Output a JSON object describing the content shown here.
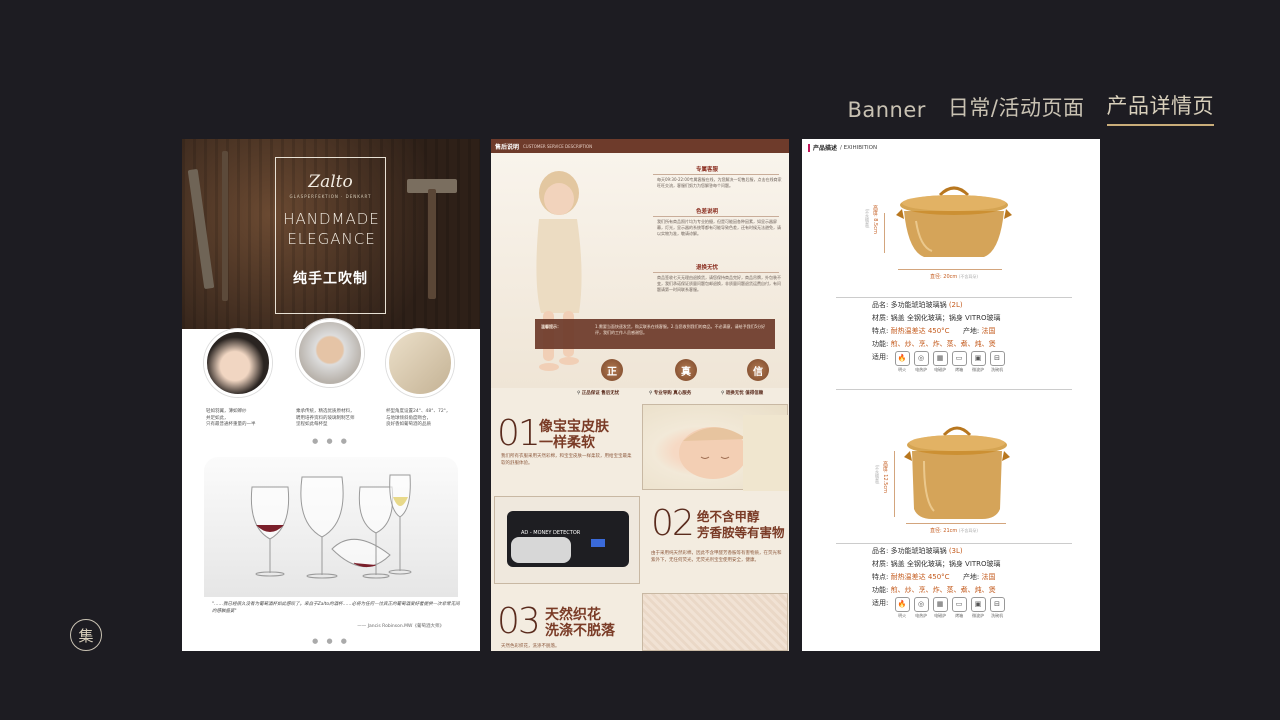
{
  "nav": {
    "items": [
      {
        "label": "Banner",
        "active": false
      },
      {
        "label": "日常/活动页面",
        "active": false
      },
      {
        "label": "产品详情页",
        "active": true
      }
    ]
  },
  "badge": {
    "label": "集"
  },
  "panel1": {
    "logo": "Zalto",
    "logo_sub": "GLASPERFEKTION · DENKART",
    "headline_line1": "HANDMADE",
    "headline_line2": "ELEGANCE",
    "headline_cn": "纯手工吹制",
    "captions": [
      "轻如羽翼，薄如蝉纱\n并足如此，\n只有最普通杯重量的一半",
      "乘承传统，精选优质原材料，\n聘用培养资料的玻璃制制艺师\n坚程如此每杯型",
      "杯型角度设置24°、48°、72°，\n与地球倾斜角度吻合，\n良好香如葡萄酒的品质"
    ],
    "quote": "\"……我已经很久没有为葡萄酒杯如此感叹了。来自于Zalto的酒杯……必将为任何一位真正的葡萄酒爱好者提供一次非常无间的感触盛宴\"",
    "author": "—— Jancis Robinson.MW《葡萄酒大师》"
  },
  "panel2": {
    "header_title": "售后说明",
    "header_sub": "CUSTOMER SERVICE DESCRIPTION",
    "sections": [
      {
        "title": "专属客服",
        "text": "每天09:30-22:00专属客服在线，为您解决一切售后服，点击在线商家旺旺交流，客服们努力为您解答每个问题。"
      },
      {
        "title": "色差说明",
        "text": "我们所有商品照片均为专业拍摄，但是可能因各种因素，如显示器屏幕，灯光，显示器的系统等都有可能导致色差，还有时候无法避免，请以实物为准，敬请谅解。"
      },
      {
        "title": "退换无忧",
        "text": "商品签收七天无理由退换货，请您保持商品完好，商品吊牌，外包装不变，我们承诺保证质量问题包邮退换，非质量问题退货运费自付，有问题请第一时间联系客服。"
      }
    ],
    "tip_label": "温馨提示：",
    "tip_text": "1.需要当面快速发货，购买联系在线客服。2.当您收到我们的商品，不必满意，请给予我们5分好评，我们的工作人员感谢您。",
    "seals": [
      "正",
      "真",
      "信"
    ],
    "slogans": [
      "正品保证 售后无忧",
      "专业导购 真心服务",
      "退换无忧 值得信赖"
    ],
    "features": [
      {
        "num": "01",
        "title_line1": "像宝宝皮肤",
        "title_line2": "一样柔软",
        "text": "我们所有衣服采用天然彩棉，和宝宝皮肤一样柔软，用给宝宝最柔软的舒服体验。"
      },
      {
        "num": "02",
        "title_line1": "绝不含甲醇",
        "title_line2": "芳香胺等有害物",
        "text": "由于采用纯天然彩棉，因此不含甲醛芳香胺等有害物质，在荧光和紫外下，无任何荧光，无荧光剂宝宝使用安全，健康。"
      },
      {
        "num": "03",
        "title_line1": "天然织花",
        "title_line2": "洗涤不脱落",
        "text": "天然色彩织花，洗涤不脱落。"
      }
    ],
    "detector_label": "AD - MONEY DETECTOR"
  },
  "panel3": {
    "header_title": "产品描述",
    "header_sub": "/ EXIHIBITION",
    "products": [
      {
        "height": "高度: 8.5cm",
        "height_note": "(不含锅盖)",
        "diameter": "直径: 20cm",
        "diameter_note": "(不含耳朵)",
        "name_key": "品名:",
        "name": "多功能琥珀玻璃锅",
        "volume": "(2L)",
        "material_key": "材质:",
        "material": "锅盖 全钢化玻璃；锅身 VITRO玻璃",
        "feature_key": "特点:",
        "feature": "耐热温差达 450°C",
        "origin_key": "产地:",
        "origin": "法国",
        "function_key": "功能:",
        "function": "煎、炒、烹、炸、蒸、煮、炖、煲",
        "use_key": "适用:"
      },
      {
        "height": "高度: 12.5cm",
        "height_note": "(不含锅盖)",
        "diameter": "直径: 21cm",
        "diameter_note": "(不含耳朵)",
        "name_key": "品名:",
        "name": "多功能琥珀玻璃锅",
        "volume": "(3L)",
        "material_key": "材质:",
        "material": "锅盖 全钢化玻璃；锅身 VITRO玻璃",
        "feature_key": "特点:",
        "feature": "耐热温差达 450°C",
        "origin_key": "产地:",
        "origin": "法国",
        "function_key": "功能:",
        "function": "煎、炒、烹、炸、蒸、煮、炖、煲",
        "use_key": "适用:"
      }
    ],
    "usage_labels": [
      "明火",
      "电热炉",
      "电磁炉",
      "烤箱",
      "微波炉",
      "洗碗机"
    ],
    "amber_color": "#c98a2a"
  }
}
